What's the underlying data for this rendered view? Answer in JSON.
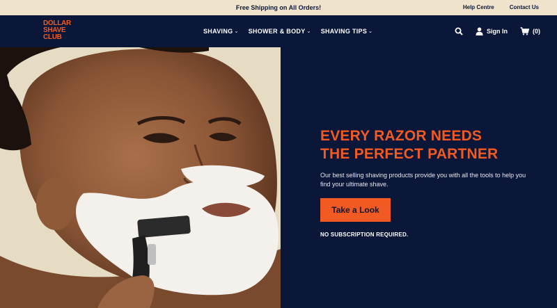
{
  "announcement": "Free Shipping on All Orders!",
  "utility_links": {
    "help": "Help Centre",
    "contact": "Contact Us"
  },
  "brand": {
    "line1": "DOLLAR",
    "line2": "SHAVE",
    "line3": "CLUB",
    "color": "#f15a22"
  },
  "nav": [
    {
      "label": "SHAVING"
    },
    {
      "label": "SHOWER & BODY"
    },
    {
      "label": "SHAVING TIPS"
    }
  ],
  "account": {
    "sign_in": "Sign In",
    "cart_count": "(0)"
  },
  "hero": {
    "headline_line1": "EVERY RAZOR NEEDS",
    "headline_line2": "THE PERFECT PARTNER",
    "subcopy": "Our best selling shaving products provide you with all the tools to help you find your ultimate shave.",
    "cta": "Take a Look",
    "note": "NO SUBSCRIPTION REQUIRED."
  },
  "colors": {
    "navy": "#0b1739",
    "orange": "#f15a22",
    "cream": "#efe3cc"
  }
}
